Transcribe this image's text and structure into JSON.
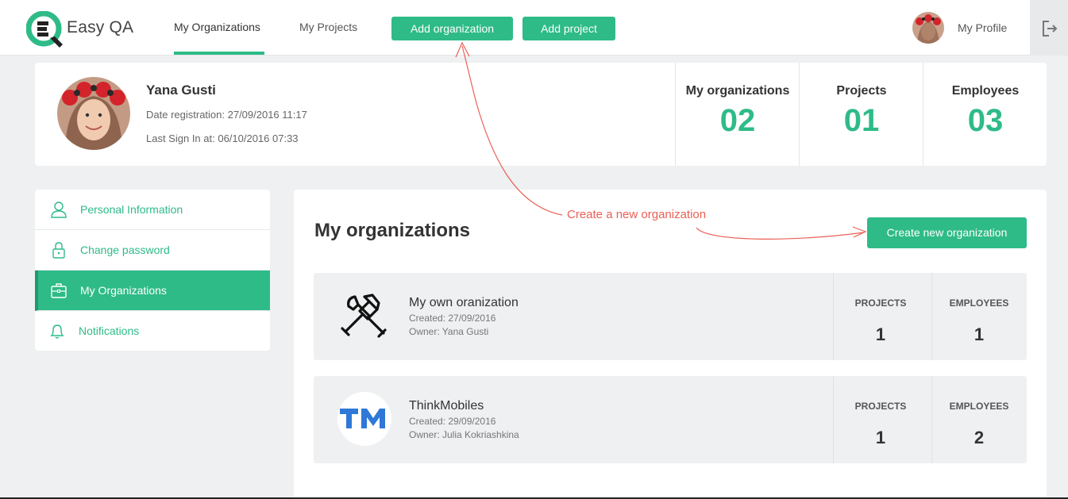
{
  "app": {
    "name": "Easy QA"
  },
  "header": {
    "nav": [
      {
        "label": "My Organizations"
      },
      {
        "label": "My Projects"
      }
    ],
    "add_organization_label": "Add organization",
    "add_project_label": "Add project",
    "profile_label": "My Profile"
  },
  "profile": {
    "name": "Yana Gusti",
    "registration": "Date registration: 27/09/2016 11:17",
    "last_sign_in": "Last Sign In at: 06/10/2016 07:33",
    "stats": [
      {
        "label": "My organizations",
        "value": "02"
      },
      {
        "label": "Projects",
        "value": "01"
      },
      {
        "label": "Employees",
        "value": "03"
      }
    ]
  },
  "sidebar": {
    "items": [
      {
        "label": "Personal Information",
        "icon": "user-icon",
        "active": false
      },
      {
        "label": "Change password",
        "icon": "lock-icon",
        "active": false
      },
      {
        "label": "My Organizations",
        "icon": "briefcase-icon",
        "active": true
      },
      {
        "label": "Notifications",
        "icon": "bell-icon",
        "active": false
      }
    ]
  },
  "main": {
    "title": "My organizations",
    "create_button_label": "Create new organization",
    "annotation": "Create a new organization",
    "organizations": [
      {
        "name": "My own oranization",
        "created": "Created: 27/09/2016",
        "owner": "Owner: Yana Gusti",
        "projects_label": "PROJECTS",
        "projects": "1",
        "employees_label": "EMPLOYEES",
        "employees": "1",
        "logo": "tools-icon"
      },
      {
        "name": "ThinkMobiles",
        "created": "Created: 29/09/2016",
        "owner": "Owner: Julia Kokriashkina",
        "projects_label": "PROJECTS",
        "projects": "1",
        "employees_label": "EMPLOYEES",
        "employees": "2",
        "logo": "tm-logo"
      }
    ]
  },
  "colors": {
    "accent": "#2ebb88",
    "annotation": "#ea5f54",
    "background": "#eef0f1"
  }
}
